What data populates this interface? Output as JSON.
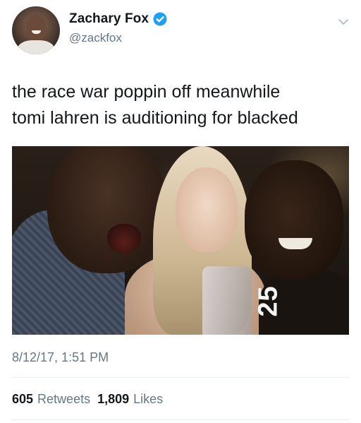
{
  "author": {
    "display_name": "Zachary Fox",
    "handle": "@zackfox",
    "verified": true
  },
  "tweet": {
    "text": "the race war poppin off meanwhile\ntomi lahren is auditioning for blacked",
    "media_overlay_number": "25",
    "timestamp": "8/12/17, 1:51 PM"
  },
  "stats": {
    "retweets_count": "605",
    "retweets_label": "Retweets",
    "likes_count": "1,809",
    "likes_label": "Likes"
  },
  "icons": {
    "verified": "verified-badge-icon",
    "menu": "chevron-down-icon"
  },
  "colors": {
    "verified_blue": "#1da1f2",
    "secondary_text": "#657786",
    "primary_text": "#14171a"
  }
}
